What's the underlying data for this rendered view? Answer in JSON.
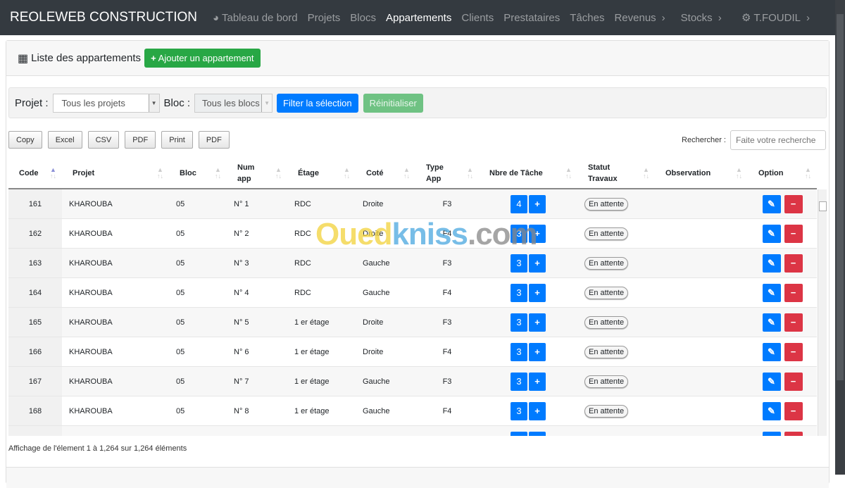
{
  "nav": {
    "brand": "REOLEWEB CONSTRUCTION",
    "items": [
      {
        "label": "Tableau de bord",
        "icon": "dashboard-icon"
      },
      {
        "label": "Projets"
      },
      {
        "label": "Blocs"
      },
      {
        "label": "Appartements",
        "active": true
      },
      {
        "label": "Clients"
      },
      {
        "label": "Prestataires"
      },
      {
        "label": "Tâches"
      },
      {
        "label": "Revenus",
        "dropdown": true
      },
      {
        "label": "Stocks",
        "dropdown": true
      }
    ],
    "user": "T.FOUDIL"
  },
  "card": {
    "title": "Liste des appartements",
    "add_label": "Ajouter un appartement"
  },
  "filter": {
    "projet_label": "Projet :",
    "projet_value": "Tous les projets",
    "bloc_label": "Bloc :",
    "bloc_value": "Tous les blocs",
    "filter_label": "Filter la sélection",
    "reset_label": "Réinitialiser"
  },
  "export": [
    "Copy",
    "Excel",
    "CSV",
    "PDF",
    "Print",
    "PDF"
  ],
  "search": {
    "label": "Rechercher :",
    "placeholder": "Faite votre recherche"
  },
  "columns": [
    "Code",
    "Projet",
    "Bloc",
    "Num app",
    "Étage",
    "Coté",
    "Type App",
    "Nbre de Tâche",
    "Statut Travaux",
    "Observation",
    "Option"
  ],
  "rows": [
    {
      "code": "161",
      "projet": "KHAROUBA",
      "bloc": "05",
      "num": "N° 1",
      "etage": "RDC",
      "cote": "Droite",
      "type": "F3",
      "taches": "4",
      "statut": "En attente",
      "observation": ""
    },
    {
      "code": "162",
      "projet": "KHAROUBA",
      "bloc": "05",
      "num": "N° 2",
      "etage": "RDC",
      "cote": "Droite",
      "type": "F4",
      "taches": "3",
      "statut": "En attente",
      "observation": ""
    },
    {
      "code": "163",
      "projet": "KHAROUBA",
      "bloc": "05",
      "num": "N° 3",
      "etage": "RDC",
      "cote": "Gauche",
      "type": "F3",
      "taches": "3",
      "statut": "En attente",
      "observation": ""
    },
    {
      "code": "164",
      "projet": "KHAROUBA",
      "bloc": "05",
      "num": "N° 4",
      "etage": "RDC",
      "cote": "Gauche",
      "type": "F4",
      "taches": "3",
      "statut": "En attente",
      "observation": ""
    },
    {
      "code": "165",
      "projet": "KHAROUBA",
      "bloc": "05",
      "num": "N° 5",
      "etage": "1 er étage",
      "cote": "Droite",
      "type": "F3",
      "taches": "3",
      "statut": "En attente",
      "observation": ""
    },
    {
      "code": "166",
      "projet": "KHAROUBA",
      "bloc": "05",
      "num": "N° 6",
      "etage": "1 er étage",
      "cote": "Droite",
      "type": "F4",
      "taches": "3",
      "statut": "En attente",
      "observation": ""
    },
    {
      "code": "167",
      "projet": "KHAROUBA",
      "bloc": "05",
      "num": "N° 7",
      "etage": "1 er étage",
      "cote": "Gauche",
      "type": "F3",
      "taches": "3",
      "statut": "En attente",
      "observation": ""
    },
    {
      "code": "168",
      "projet": "KHAROUBA",
      "bloc": "05",
      "num": "N° 8",
      "etage": "1 er étage",
      "cote": "Gauche",
      "type": "F4",
      "taches": "3",
      "statut": "En attente",
      "observation": ""
    }
  ],
  "info": "Affichage de l'élement 1 à 1,264 sur 1,264 éléments",
  "watermark": "Ouedkniss.com",
  "colors": {
    "navbar": "#343a40",
    "primary": "#007bff",
    "success": "#28a745",
    "danger": "#dc3545"
  }
}
